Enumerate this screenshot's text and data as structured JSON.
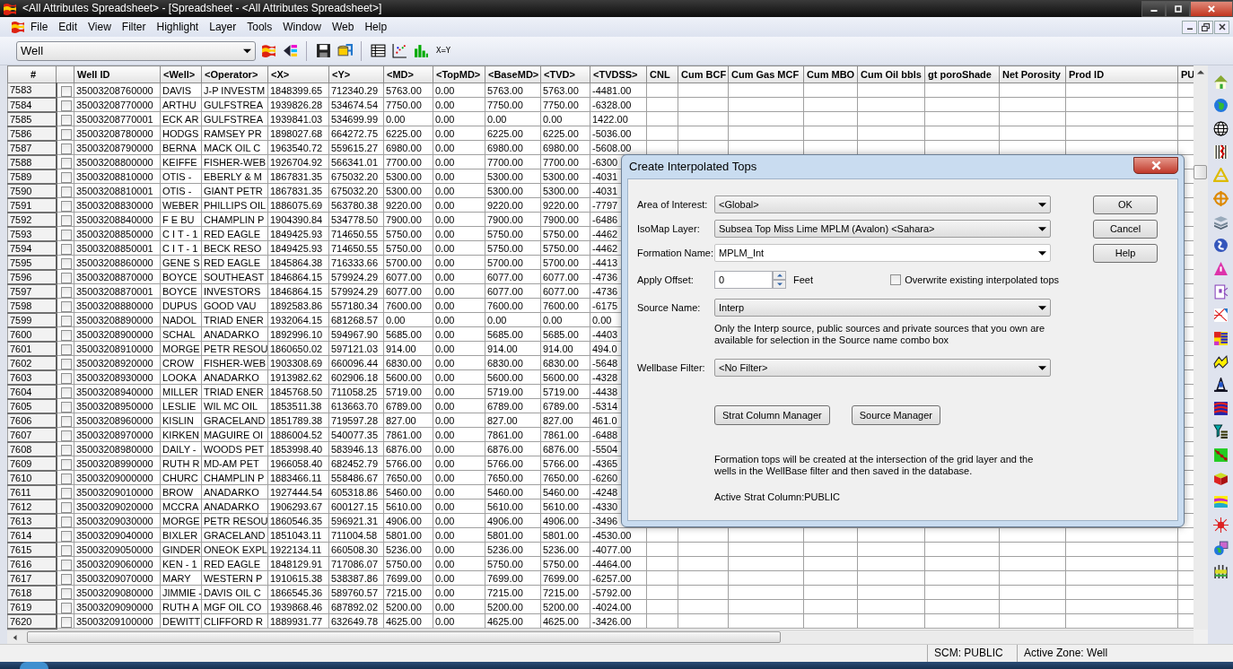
{
  "window": {
    "title": "<All Attributes Spreadsheet> - [Spreadsheet - <All Attributes Spreadsheet>]"
  },
  "menu": [
    "File",
    "Edit",
    "View",
    "Filter",
    "Highlight",
    "Layer",
    "Tools",
    "Window",
    "Web",
    "Help"
  ],
  "toolbar": {
    "layer_select": "Well",
    "xy_button": "X=Y"
  },
  "table": {
    "index_header": "#",
    "columns": [
      "Well ID",
      "<Well>",
      "<Operator>",
      "<X>",
      "<Y>",
      "<MD>",
      "<TopMD>",
      "<BaseMD>",
      "<TVD>",
      "<TVDSS>",
      "CNL",
      "Cum BCF",
      "Cum Gas MCF",
      "Cum MBO",
      "Cum Oil bbls",
      "gt poroShade",
      "Net Porosity",
      "Prod ID",
      "PU"
    ],
    "rows": [
      {
        "num": "7583",
        "checked": false,
        "cells": [
          "35003208760000",
          "DAVIS",
          "J-P INVESTM",
          "1848399.65",
          "712340.29",
          "5763.00",
          "0.00",
          "5763.00",
          "5763.00",
          "-4481.00"
        ]
      },
      {
        "num": "7584",
        "checked": false,
        "cells": [
          "35003208770000",
          "ARTHU",
          "GULFSTREA",
          "1939826.28",
          "534674.54",
          "7750.00",
          "0.00",
          "7750.00",
          "7750.00",
          "-6328.00"
        ]
      },
      {
        "num": "7585",
        "checked": false,
        "cells": [
          "35003208770001",
          "ECK AR",
          "GULFSTREA",
          "1939841.03",
          "534699.99",
          "0.00",
          "0.00",
          "0.00",
          "0.00",
          "1422.00"
        ]
      },
      {
        "num": "7586",
        "checked": false,
        "cells": [
          "35003208780000",
          "HODGS",
          "RAMSEY PR",
          "1898027.68",
          "664272.75",
          "6225.00",
          "0.00",
          "6225.00",
          "6225.00",
          "-5036.00"
        ]
      },
      {
        "num": "7587",
        "checked": false,
        "cells": [
          "35003208790000",
          "BERNA",
          "MACK OIL C",
          "1963540.72",
          "559615.27",
          "6980.00",
          "0.00",
          "6980.00",
          "6980.00",
          "-5608.00"
        ]
      },
      {
        "num": "7588",
        "checked": false,
        "cells": [
          "35003208800000",
          "KEIFFE",
          "FISHER-WEB",
          "1926704.92",
          "566341.01",
          "7700.00",
          "0.00",
          "7700.00",
          "7700.00",
          "-6300"
        ]
      },
      {
        "num": "7589",
        "checked": false,
        "cells": [
          "35003208810000",
          "OTIS -",
          "EBERLY & M",
          "1867831.35",
          "675032.20",
          "5300.00",
          "0.00",
          "5300.00",
          "5300.00",
          "-4031"
        ]
      },
      {
        "num": "7590",
        "checked": false,
        "cells": [
          "35003208810001",
          "OTIS -",
          "GIANT PETR",
          "1867831.35",
          "675032.20",
          "5300.00",
          "0.00",
          "5300.00",
          "5300.00",
          "-4031"
        ]
      },
      {
        "num": "7591",
        "checked": false,
        "cells": [
          "35003208830000",
          "WEBER",
          "PHILLIPS OIL",
          "1886075.69",
          "563780.38",
          "9220.00",
          "0.00",
          "9220.00",
          "9220.00",
          "-7797"
        ]
      },
      {
        "num": "7592",
        "checked": false,
        "cells": [
          "35003208840000",
          "F E BU",
          "CHAMPLIN P",
          "1904390.84",
          "534778.50",
          "7900.00",
          "0.00",
          "7900.00",
          "7900.00",
          "-6486"
        ]
      },
      {
        "num": "7593",
        "checked": false,
        "cells": [
          "35003208850000",
          "C I T - 1",
          "RED EAGLE",
          "1849425.93",
          "714650.55",
          "5750.00",
          "0.00",
          "5750.00",
          "5750.00",
          "-4462"
        ]
      },
      {
        "num": "7594",
        "checked": false,
        "cells": [
          "35003208850001",
          "C I T - 1",
          "BECK RESO",
          "1849425.93",
          "714650.55",
          "5750.00",
          "0.00",
          "5750.00",
          "5750.00",
          "-4462"
        ]
      },
      {
        "num": "7595",
        "checked": false,
        "cells": [
          "35003208860000",
          "GENE S",
          "RED EAGLE",
          "1845864.38",
          "716333.66",
          "5700.00",
          "0.00",
          "5700.00",
          "5700.00",
          "-4413"
        ]
      },
      {
        "num": "7596",
        "checked": false,
        "cells": [
          "35003208870000",
          "BOYCE",
          "SOUTHEAST",
          "1846864.15",
          "579924.29",
          "6077.00",
          "0.00",
          "6077.00",
          "6077.00",
          "-4736"
        ]
      },
      {
        "num": "7597",
        "checked": false,
        "cells": [
          "35003208870001",
          "BOYCE",
          "INVESTORS",
          "1846864.15",
          "579924.29",
          "6077.00",
          "0.00",
          "6077.00",
          "6077.00",
          "-4736"
        ]
      },
      {
        "num": "7598",
        "checked": false,
        "cells": [
          "35003208880000",
          "DUPUS",
          "GOOD VAU",
          "1892583.86",
          "557180.34",
          "7600.00",
          "0.00",
          "7600.00",
          "7600.00",
          "-6175"
        ]
      },
      {
        "num": "7599",
        "checked": false,
        "cells": [
          "35003208890000",
          "NADOL",
          "TRIAD ENER",
          "1932064.15",
          "681268.57",
          "0.00",
          "0.00",
          "0.00",
          "0.00",
          "0.00"
        ]
      },
      {
        "num": "7600",
        "checked": false,
        "cells": [
          "35003208900000",
          "SCHAL",
          "ANADARKO",
          "1892996.10",
          "594967.90",
          "5685.00",
          "0.00",
          "5685.00",
          "5685.00",
          "-4403"
        ]
      },
      {
        "num": "7601",
        "checked": false,
        "cells": [
          "35003208910000",
          "MORGE",
          "PETR RESOU",
          "1860650.02",
          "597121.03",
          "914.00",
          "0.00",
          "914.00",
          "914.00",
          "494.0"
        ]
      },
      {
        "num": "7602",
        "checked": false,
        "cells": [
          "35003208920000",
          "CROW",
          "FISHER-WEB",
          "1903308.69",
          "660096.44",
          "6830.00",
          "0.00",
          "6830.00",
          "6830.00",
          "-5648"
        ]
      },
      {
        "num": "7603",
        "checked": false,
        "cells": [
          "35003208930000",
          "LOOKA",
          "ANADARKO",
          "1913982.62",
          "602906.18",
          "5600.00",
          "0.00",
          "5600.00",
          "5600.00",
          "-4328"
        ]
      },
      {
        "num": "7604",
        "checked": false,
        "cells": [
          "35003208940000",
          "MILLER",
          "TRIAD ENER",
          "1845768.50",
          "711058.25",
          "5719.00",
          "0.00",
          "5719.00",
          "5719.00",
          "-4438"
        ]
      },
      {
        "num": "7605",
        "checked": false,
        "cells": [
          "35003208950000",
          "LESLIE",
          "WIL MC OIL",
          "1853511.38",
          "613663.70",
          "6789.00",
          "0.00",
          "6789.00",
          "6789.00",
          "-5314"
        ]
      },
      {
        "num": "7606",
        "checked": false,
        "cells": [
          "35003208960000",
          "KISLIN",
          "GRACELAND",
          "1851789.38",
          "719597.28",
          "827.00",
          "0.00",
          "827.00",
          "827.00",
          "461.0"
        ]
      },
      {
        "num": "7607",
        "checked": false,
        "cells": [
          "35003208970000",
          "KIRKEN",
          "MAGUIRE OI",
          "1886004.52",
          "540077.35",
          "7861.00",
          "0.00",
          "7861.00",
          "7861.00",
          "-6488"
        ]
      },
      {
        "num": "7608",
        "checked": false,
        "cells": [
          "35003208980000",
          "DAILY -",
          "WOODS PET",
          "1853998.40",
          "583946.13",
          "6876.00",
          "0.00",
          "6876.00",
          "6876.00",
          "-5504"
        ]
      },
      {
        "num": "7609",
        "checked": false,
        "cells": [
          "35003208990000",
          "RUTH R",
          "MD-AM PET",
          "1966058.40",
          "682452.79",
          "5766.00",
          "0.00",
          "5766.00",
          "5766.00",
          "-4365"
        ]
      },
      {
        "num": "7610",
        "checked": false,
        "cells": [
          "35003209000000",
          "CHURC",
          "CHAMPLIN P",
          "1883466.11",
          "558486.67",
          "7650.00",
          "0.00",
          "7650.00",
          "7650.00",
          "-6260"
        ]
      },
      {
        "num": "7611",
        "checked": false,
        "cells": [
          "35003209010000",
          "BROW",
          "ANADARKO",
          "1927444.54",
          "605318.86",
          "5460.00",
          "0.00",
          "5460.00",
          "5460.00",
          "-4248"
        ]
      },
      {
        "num": "7612",
        "checked": false,
        "cells": [
          "35003209020000",
          "MCCRA",
          "ANADARKO",
          "1906293.67",
          "600127.15",
          "5610.00",
          "0.00",
          "5610.00",
          "5610.00",
          "-4330"
        ]
      },
      {
        "num": "7613",
        "checked": false,
        "cells": [
          "35003209030000",
          "MORGE",
          "PETR RESOU",
          "1860546.35",
          "596921.31",
          "4906.00",
          "0.00",
          "4906.00",
          "4906.00",
          "-3496"
        ]
      },
      {
        "num": "7614",
        "checked": false,
        "cells": [
          "35003209040000",
          "BIXLER",
          "GRACELAND",
          "1851043.11",
          "711004.58",
          "5801.00",
          "0.00",
          "5801.00",
          "5801.00",
          "-4530.00"
        ]
      },
      {
        "num": "7615",
        "checked": false,
        "cells": [
          "35003209050000",
          "GINDER",
          "ONEOK EXPL",
          "1922134.11",
          "660508.30",
          "5236.00",
          "0.00",
          "5236.00",
          "5236.00",
          "-4077.00"
        ]
      },
      {
        "num": "7616",
        "checked": false,
        "cells": [
          "35003209060000",
          "KEN - 1",
          "RED EAGLE",
          "1848129.91",
          "717086.07",
          "5750.00",
          "0.00",
          "5750.00",
          "5750.00",
          "-4464.00"
        ]
      },
      {
        "num": "7617",
        "checked": false,
        "cells": [
          "35003209070000",
          "MARY",
          "WESTERN P",
          "1910615.38",
          "538387.86",
          "7699.00",
          "0.00",
          "7699.00",
          "7699.00",
          "-6257.00"
        ]
      },
      {
        "num": "7618",
        "checked": false,
        "cells": [
          "35003209080000",
          "JIMMIE -",
          "DAVIS OIL C",
          "1866545.36",
          "589760.57",
          "7215.00",
          "0.00",
          "7215.00",
          "7215.00",
          "-5792.00"
        ]
      },
      {
        "num": "7619",
        "checked": false,
        "cells": [
          "35003209090000",
          "RUTH A",
          "MGF OIL CO",
          "1939868.46",
          "687892.02",
          "5200.00",
          "0.00",
          "5200.00",
          "5200.00",
          "-4024.00"
        ]
      },
      {
        "num": "7620",
        "checked": false,
        "cells": [
          "35003209100000",
          "DEWITT",
          "CLIFFORD R",
          "1889931.77",
          "632649.78",
          "4625.00",
          "0.00",
          "4625.00",
          "4625.00",
          "-3426.00"
        ]
      }
    ]
  },
  "dialog": {
    "title": "Create Interpolated Tops",
    "fields": [
      {
        "kind": "select",
        "label": "Area of Interest:",
        "value": "<Global>"
      },
      {
        "kind": "select",
        "label": "IsoMap Layer:",
        "value": "Subsea Top Miss Lime MPLM (Avalon) <Sahara>"
      },
      {
        "kind": "combo",
        "label": "Formation Name:",
        "value": "MPLM_Int"
      },
      {
        "kind": "spin",
        "label": "Apply Offset:",
        "value": "0",
        "unit": "Feet",
        "option": {
          "label": "Overwrite existing interpolated tops",
          "checked": false
        }
      },
      {
        "kind": "select",
        "label": "Source Name:",
        "value": "Interp",
        "note": "Only the Interp source, public sources and private sources that you own are available for selection in the Source name combo box"
      },
      {
        "kind": "select",
        "label": "Wellbase Filter:",
        "value": "<No Filter>"
      }
    ],
    "side_buttons": [
      "OK",
      "Cancel",
      "Help"
    ],
    "buttons": [
      "Strat Column Manager",
      "Source Manager"
    ],
    "note": "Formation tops will be created at the intersection of the grid layer and the wells in the WellBase filter and then saved in the database.",
    "active_column": "Active Strat Column:PUBLIC"
  },
  "status_bar": [
    "SCM: PUBLIC",
    "Active Zone: Well"
  ]
}
